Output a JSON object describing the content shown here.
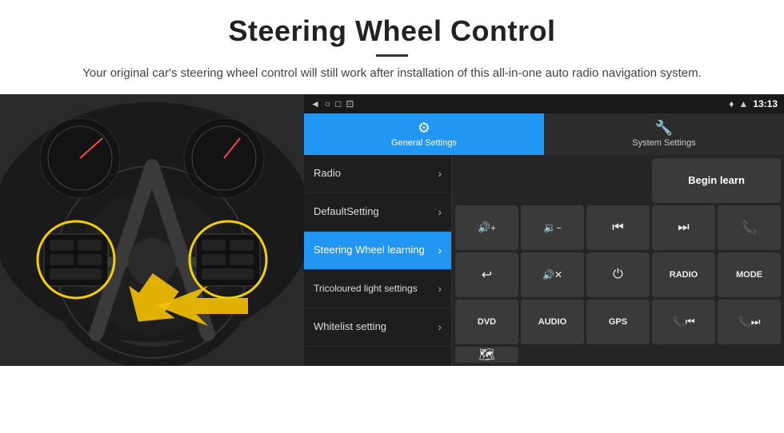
{
  "header": {
    "title": "Steering Wheel Control",
    "subtitle": "Your original car's steering wheel control will still work after installation of this all-in-one auto radio navigation system."
  },
  "status_bar": {
    "time": "13:13",
    "icons": [
      "◄",
      "○",
      "□",
      "⊡"
    ]
  },
  "tabs": [
    {
      "id": "general",
      "label": "General Settings",
      "icon": "⚙",
      "active": true
    },
    {
      "id": "system",
      "label": "System Settings",
      "icon": "⚙",
      "active": false
    }
  ],
  "menu_items": [
    {
      "id": "radio",
      "label": "Radio",
      "active": false
    },
    {
      "id": "default-setting",
      "label": "DefaultSetting",
      "active": false
    },
    {
      "id": "steering-wheel",
      "label": "Steering Wheel learning",
      "active": true
    },
    {
      "id": "tricoloured-light",
      "label": "Tricoloured light settings",
      "active": false
    },
    {
      "id": "whitelist",
      "label": "Whitelist setting",
      "active": false
    }
  ],
  "begin_learn_label": "Begin learn",
  "grid_buttons": [
    {
      "id": "vol-up",
      "label": "🔊+",
      "type": "icon"
    },
    {
      "id": "vol-down",
      "label": "🔉−",
      "type": "icon"
    },
    {
      "id": "prev-track",
      "label": "⏮",
      "type": "icon"
    },
    {
      "id": "next-track",
      "label": "⏭",
      "type": "icon"
    },
    {
      "id": "phone",
      "label": "📞",
      "type": "icon"
    },
    {
      "id": "hang-up",
      "label": "↩",
      "type": "icon"
    },
    {
      "id": "mute",
      "label": "🔊×",
      "type": "icon"
    },
    {
      "id": "power",
      "label": "⏻",
      "type": "icon"
    },
    {
      "id": "radio-btn",
      "label": "RADIO",
      "type": "text"
    },
    {
      "id": "mode-btn",
      "label": "MODE",
      "type": "text"
    },
    {
      "id": "dvd-btn",
      "label": "DVD",
      "type": "text"
    },
    {
      "id": "audio-btn",
      "label": "AUDIO",
      "type": "text"
    },
    {
      "id": "gps-btn",
      "label": "GPS",
      "type": "text"
    },
    {
      "id": "tel-prev",
      "label": "📞⏮",
      "type": "icon"
    },
    {
      "id": "tel-next",
      "label": "📞⏭",
      "type": "icon"
    },
    {
      "id": "map-btn",
      "label": "🗺",
      "type": "icon"
    }
  ]
}
